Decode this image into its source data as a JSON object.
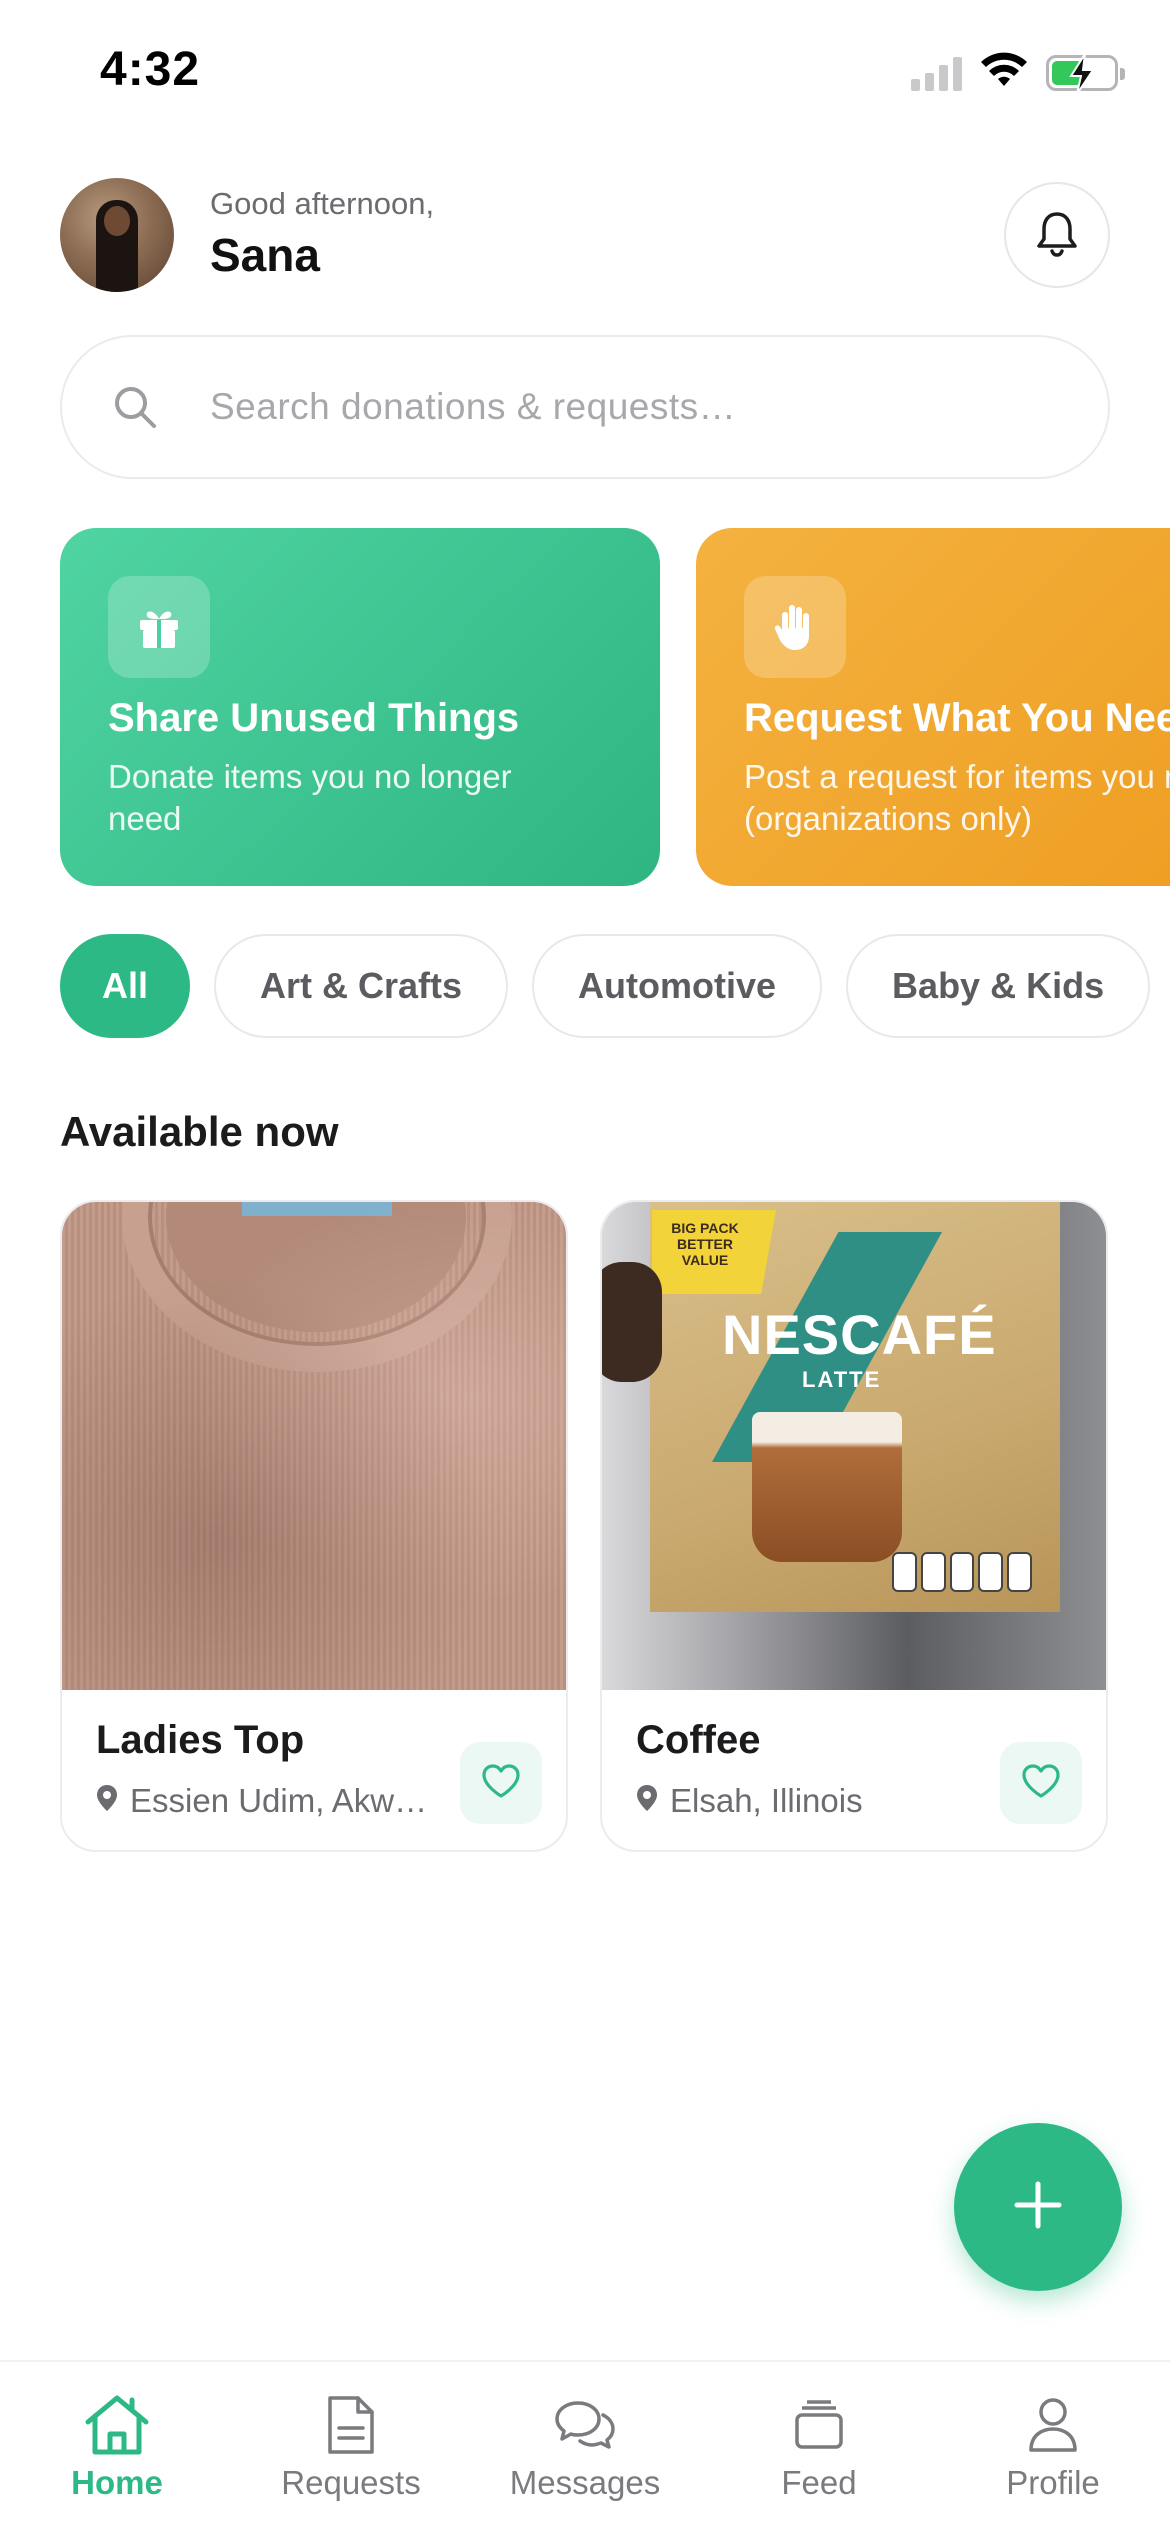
{
  "status_bar": {
    "time": "4:32"
  },
  "header": {
    "greeting": "Good afternoon,",
    "user_name": "Sana"
  },
  "search": {
    "placeholder": "Search donations & requests…"
  },
  "promos": [
    {
      "title": "Share Unused Things",
      "subtitle": "Donate items you no longer need",
      "icon": "gift-icon",
      "color": "#3cc694"
    },
    {
      "title": "Request What You Need",
      "subtitle": "Post a request for items you need (organizations only)",
      "icon": "hand-icon",
      "color": "#f2a630"
    }
  ],
  "categories": {
    "selected": "All",
    "items": [
      "All",
      "Art & Crafts",
      "Automotive",
      "Baby & Kids"
    ]
  },
  "section_title": "Available now",
  "items": [
    {
      "name": "Ladies Top",
      "location": "Essien Udim, Akw…"
    },
    {
      "name": "Coffee",
      "location": "Elsah, Illinois"
    }
  ],
  "coffee_image_text": {
    "badge": "BIG PACK BETTER VALUE",
    "brand": "NESCAFÉ",
    "variant": "LATTE"
  },
  "tabs": [
    {
      "label": "Home",
      "active": true
    },
    {
      "label": "Requests",
      "active": false
    },
    {
      "label": "Messages",
      "active": false
    },
    {
      "label": "Feed",
      "active": false
    },
    {
      "label": "Profile",
      "active": false
    }
  ],
  "colors": {
    "accent": "#2db985",
    "orange": "#f2a630",
    "text": "#1b1b1e",
    "muted": "#6b6b70"
  }
}
